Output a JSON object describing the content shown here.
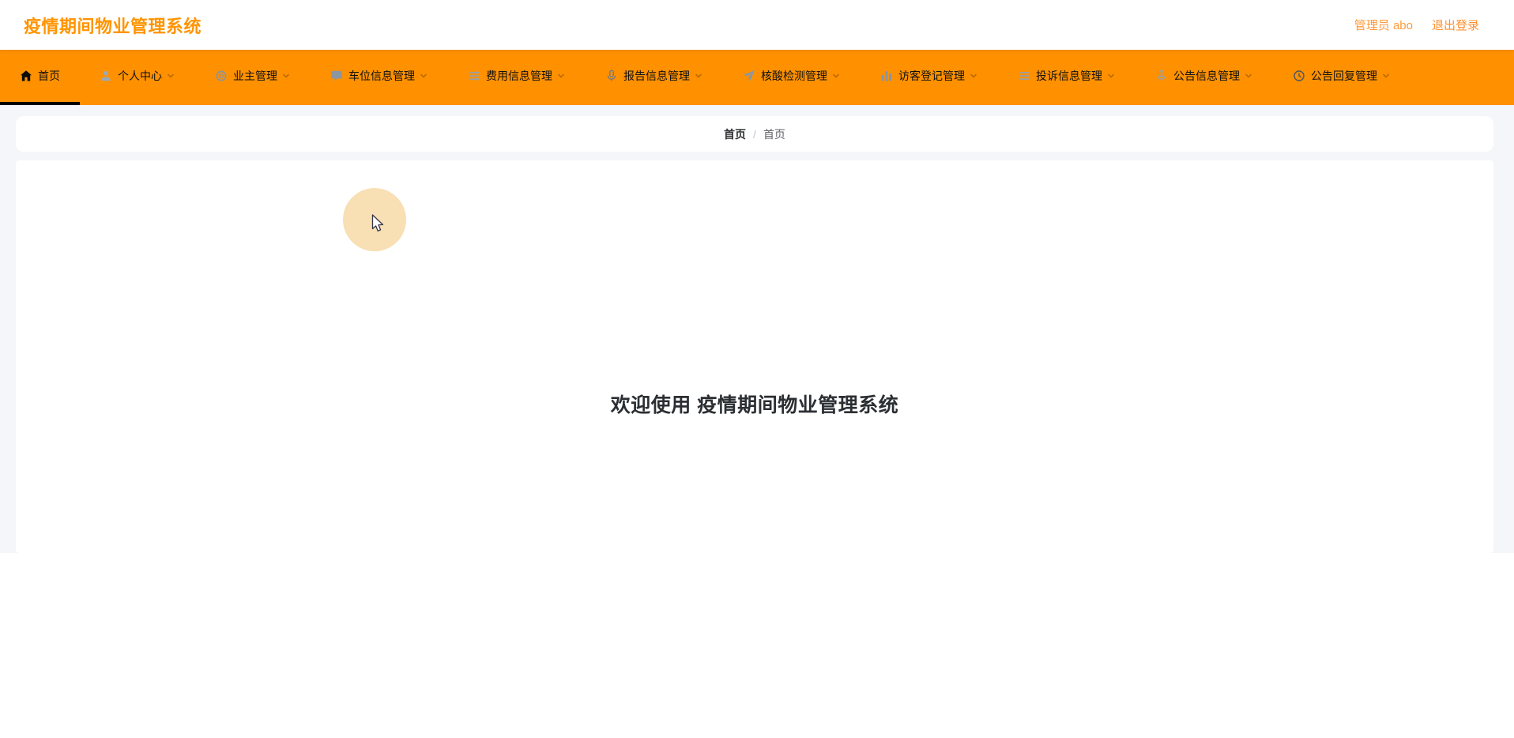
{
  "header": {
    "title": "疫情期间物业管理系统",
    "user_label": "管理员 abo",
    "logout_label": "退出登录"
  },
  "nav": {
    "items": [
      {
        "label": "首页",
        "icon": "home-icon",
        "active": true,
        "has_dropdown": false
      },
      {
        "label": "个人中心",
        "icon": "user-icon",
        "active": false,
        "has_dropdown": true
      },
      {
        "label": "业主管理",
        "icon": "ring-icon",
        "active": false,
        "has_dropdown": true
      },
      {
        "label": "车位信息管理",
        "icon": "chat-icon",
        "active": false,
        "has_dropdown": true
      },
      {
        "label": "费用信息管理",
        "icon": "sliders-icon",
        "active": false,
        "has_dropdown": true
      },
      {
        "label": "报告信息管理",
        "icon": "microphone-icon",
        "active": false,
        "has_dropdown": true
      },
      {
        "label": "核酸检测管理",
        "icon": "paper-plane-icon",
        "active": false,
        "has_dropdown": true
      },
      {
        "label": "访客登记管理",
        "icon": "bar-chart-icon",
        "active": false,
        "has_dropdown": true
      },
      {
        "label": "投诉信息管理",
        "icon": "list-icon",
        "active": false,
        "has_dropdown": true
      },
      {
        "label": "公告信息管理",
        "icon": "microphone-icon",
        "active": false,
        "has_dropdown": true
      },
      {
        "label": "公告回复管理",
        "icon": "clock-icon",
        "active": false,
        "has_dropdown": true
      }
    ]
  },
  "breadcrumb": {
    "root": "首页",
    "separator": "/",
    "current": "首页"
  },
  "main": {
    "welcome_text": "欢迎使用 疫情期间物业管理系统"
  },
  "colors": {
    "nav_bg": "#ff9100",
    "title_orange": "#ff9400",
    "link_orange": "#ff8f2e",
    "page_bg": "#f4f6f9",
    "active_indicator": "#000000",
    "circle_fill": "#f8dfb4",
    "welcome_text": "#2b2f33"
  }
}
